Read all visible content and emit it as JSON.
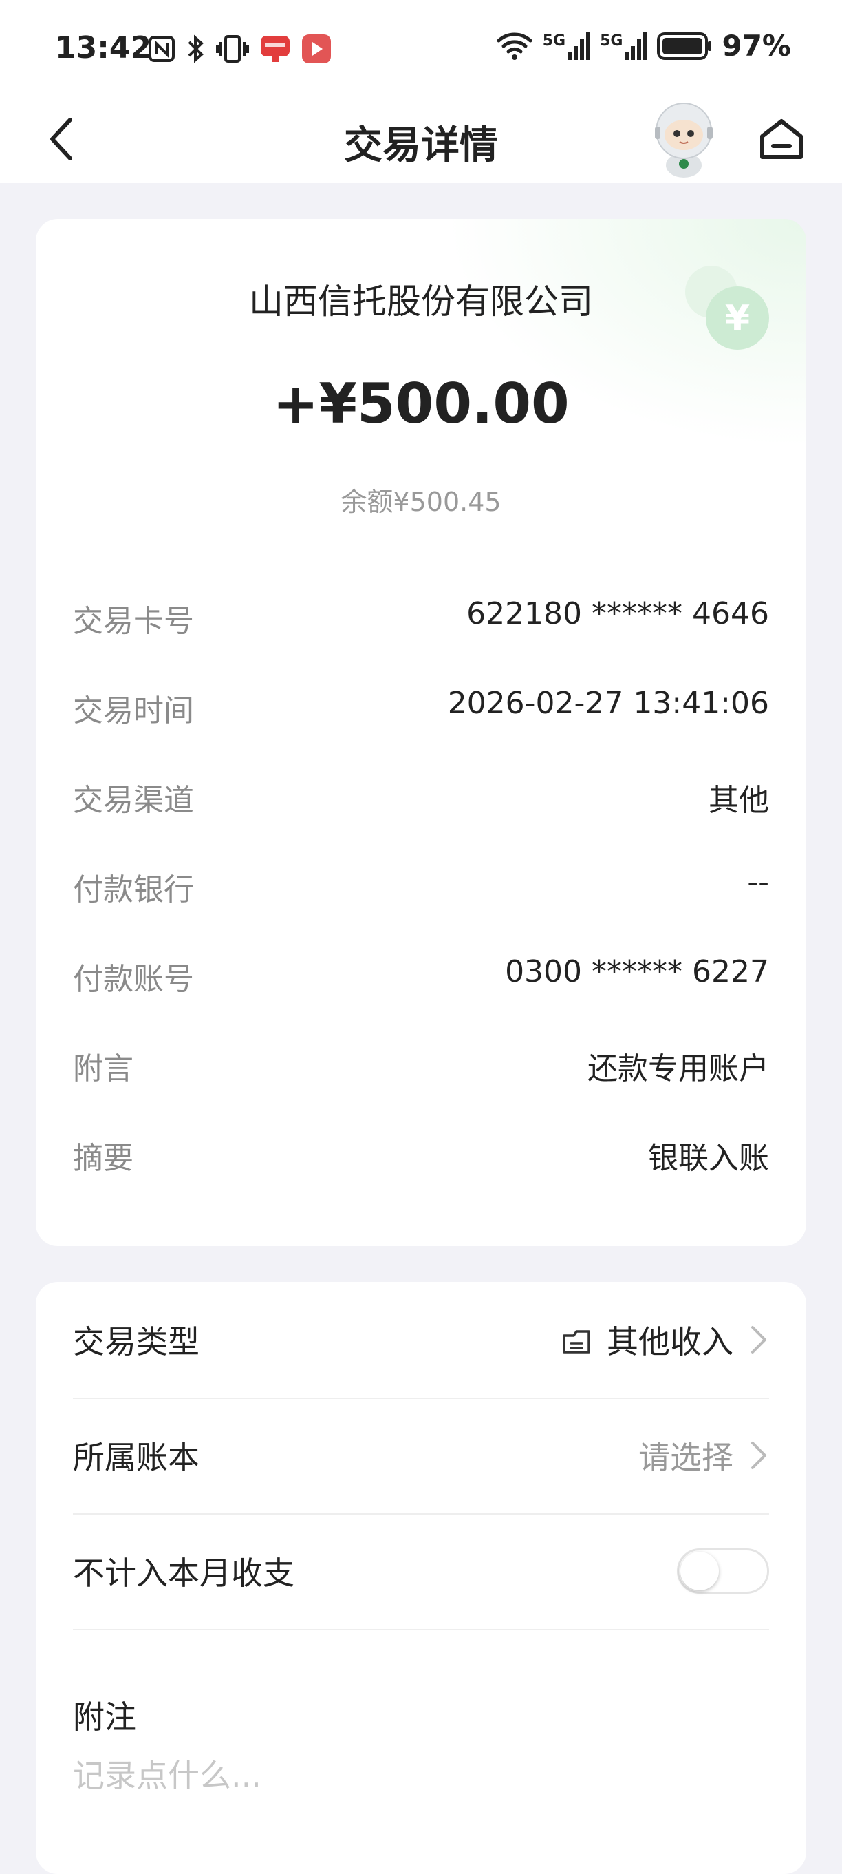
{
  "status_bar": {
    "time": "13:42",
    "battery": "97%",
    "network_1": "5G",
    "network_2": "5G"
  },
  "header": {
    "title": "交易详情"
  },
  "transaction": {
    "merchant": "山西信托股份有限公司",
    "amount": "+¥500.00",
    "balance": "余额¥500.45"
  },
  "details": [
    {
      "label": "交易卡号",
      "value": "622180 ****** 4646"
    },
    {
      "label": "交易时间",
      "value": "2026-02-27 13:41:06"
    },
    {
      "label": "交易渠道",
      "value": "其他"
    },
    {
      "label": "付款银行",
      "value": "--"
    },
    {
      "label": "付款账号",
      "value": "0300 ****** 6227"
    },
    {
      "label": "附言",
      "value": "还款专用账户"
    },
    {
      "label": "摘要",
      "value": "银联入账"
    }
  ],
  "settings": {
    "type_label": "交易类型",
    "type_value": "其他收入",
    "book_label": "所属账本",
    "book_placeholder": "请选择",
    "exclude_label": "不计入本月收支",
    "exclude_enabled": false,
    "note_label": "附注",
    "note_placeholder": "记录点什么..."
  },
  "colors": {
    "accent_green": "#d9f0dd",
    "background": "#f2f2f7"
  }
}
